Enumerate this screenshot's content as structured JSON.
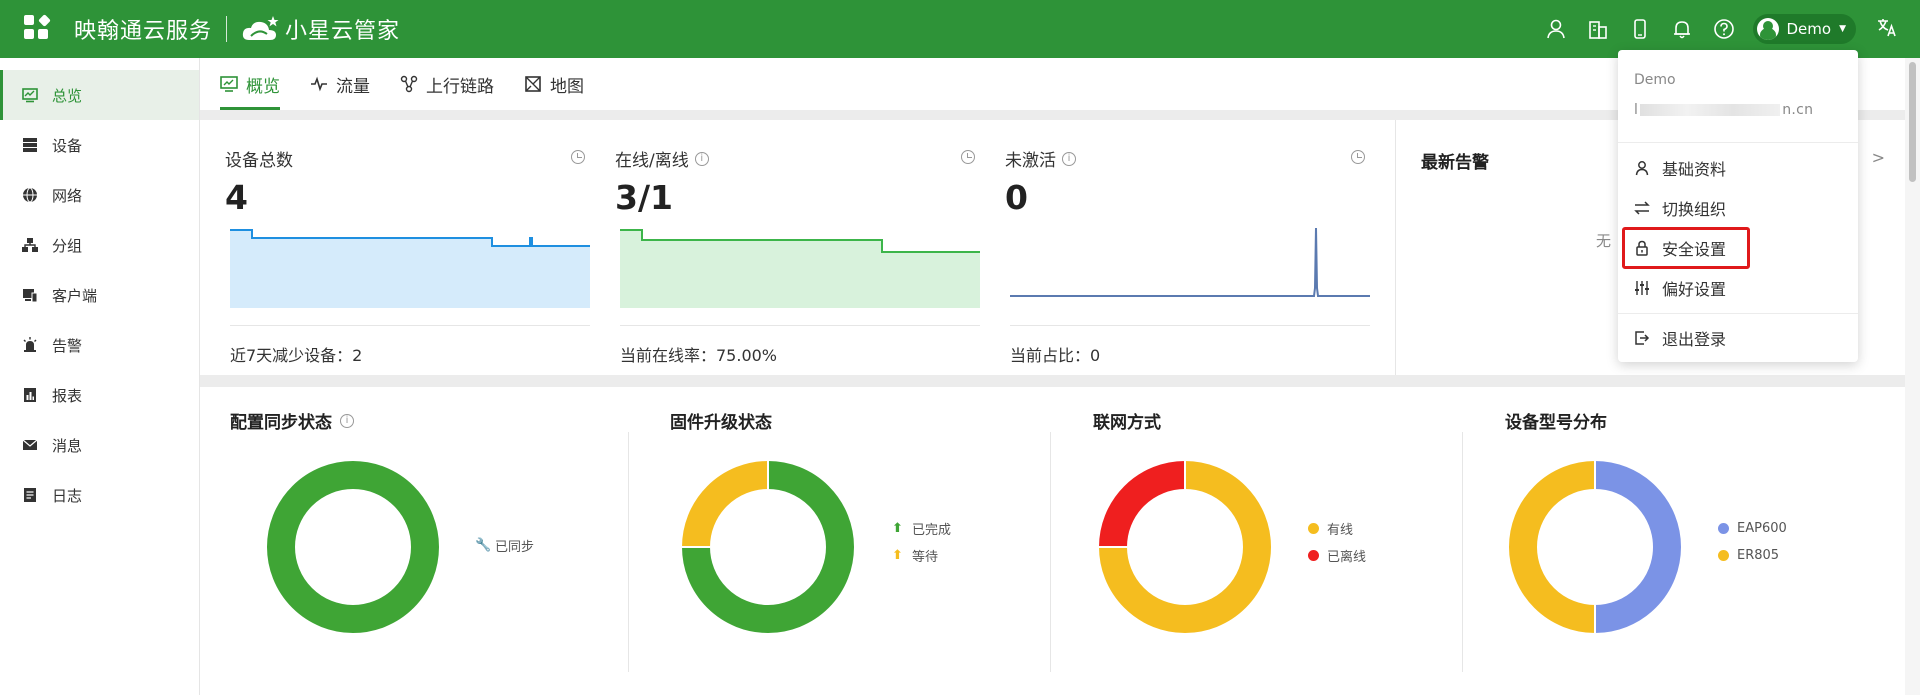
{
  "header": {
    "brand": "映翰通云服务",
    "product": "小星云管家",
    "user_name": "Demo"
  },
  "sidebar": {
    "items": [
      {
        "label": "总览",
        "icon": "overview-icon",
        "active": true
      },
      {
        "label": "设备",
        "icon": "device-icon"
      },
      {
        "label": "网络",
        "icon": "globe-icon"
      },
      {
        "label": "分组",
        "icon": "group-icon"
      },
      {
        "label": "客户端",
        "icon": "client-icon"
      },
      {
        "label": "告警",
        "icon": "alarm-icon"
      },
      {
        "label": "报表",
        "icon": "report-icon"
      },
      {
        "label": "消息",
        "icon": "mail-icon"
      },
      {
        "label": "日志",
        "icon": "log-icon"
      }
    ]
  },
  "tabs": [
    {
      "label": "概览",
      "active": true
    },
    {
      "label": "流量"
    },
    {
      "label": "上行链路"
    },
    {
      "label": "地图"
    }
  ],
  "stats": [
    {
      "title": "设备总数",
      "value": "4",
      "footer": "近7天减少设备：2",
      "color": "#1e8fe0",
      "fill": "#d5ebfb"
    },
    {
      "title": "在线/离线",
      "value": "3/1",
      "footer": "当前在线率：75.00%",
      "color": "#3cb54a",
      "fill": "#d8f2dc"
    },
    {
      "title": "未激活",
      "value": "0",
      "footer": "当前占比：0",
      "color": "#5b7ab0",
      "fill": "none"
    }
  ],
  "alerts": {
    "title": "最新告警",
    "more": ">",
    "empty": "无"
  },
  "charts": [
    {
      "title": "配置同步状态",
      "has_info": true,
      "segments": [
        {
          "label": "已同步",
          "value": 100,
          "color": "#3fa535"
        }
      ]
    },
    {
      "title": "固件升级状态",
      "has_info": false,
      "segments": [
        {
          "label": "已完成",
          "value": 75,
          "color": "#3fa535"
        },
        {
          "label": "等待",
          "value": 25,
          "color": "#f5bd1f"
        }
      ]
    },
    {
      "title": "联网方式",
      "has_info": false,
      "segments": [
        {
          "label": "有线",
          "value": 75,
          "color": "#f5bd1f"
        },
        {
          "label": "已离线",
          "value": 25,
          "color": "#ef1f1f"
        }
      ]
    },
    {
      "title": "设备型号分布",
      "has_info": false,
      "segments": [
        {
          "label": "EAP600",
          "value": 50,
          "color": "#7b93e6"
        },
        {
          "label": "ER805",
          "value": 50,
          "color": "#f5bd1f"
        }
      ]
    }
  ],
  "dropdown": {
    "name": "Demo",
    "email_start": "l",
    "email_end": "n.cn",
    "items": [
      {
        "label": "基础资料",
        "icon": "user-icon"
      },
      {
        "label": "切换组织",
        "icon": "switch-icon"
      },
      {
        "label": "安全设置",
        "icon": "lock-icon"
      },
      {
        "label": "偏好设置",
        "icon": "sliders-icon"
      },
      {
        "label": "退出登录",
        "icon": "logout-icon"
      }
    ]
  }
}
